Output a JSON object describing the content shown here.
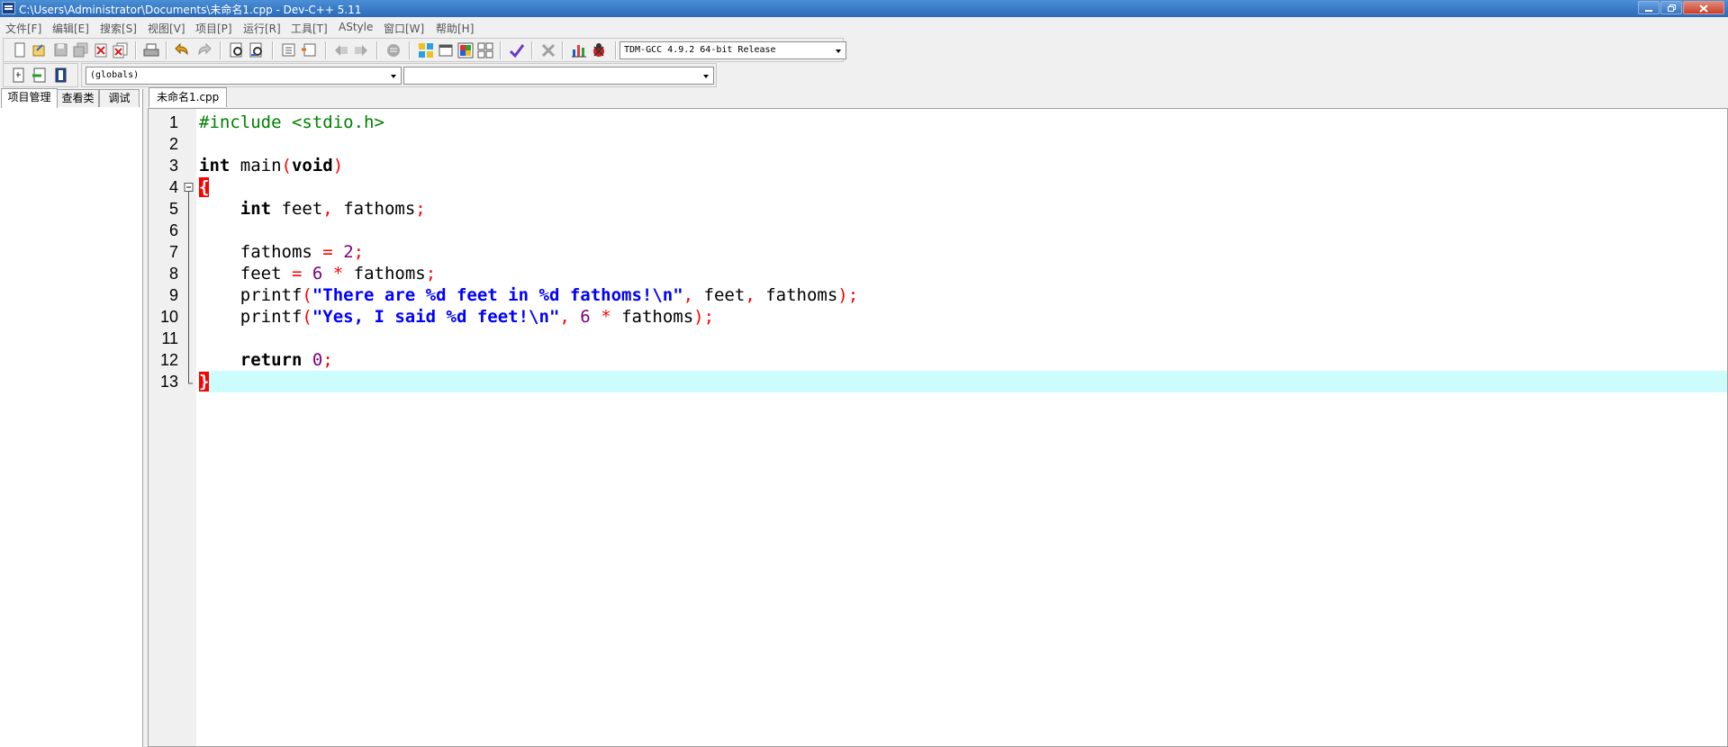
{
  "window": {
    "title": "C:\\Users\\Administrator\\Documents\\未命名1.cpp - Dev-C++ 5.11",
    "controls": [
      "minimize",
      "restore",
      "close"
    ]
  },
  "menu": {
    "items": [
      "文件[F]",
      "编辑[E]",
      "搜索[S]",
      "视图[V]",
      "项目[P]",
      "运行[R]",
      "工具[T]",
      "AStyle",
      "窗口[W]",
      "帮助[H]"
    ]
  },
  "toolbar": {
    "compiler_select": "TDM-GCC 4.9.2 64-bit Release",
    "scope_select": "(globals)",
    "member_select": "",
    "icons": [
      "new-file-icon",
      "open-file-icon",
      "save-icon",
      "save-all-icon",
      "close-file-icon",
      "close-all-icon",
      "print-icon",
      "undo-icon",
      "redo-icon",
      "find-icon",
      "replace-icon",
      "indent-icon",
      "unindent-icon",
      "prev-bookmark-icon",
      "next-bookmark-icon",
      "toggle-comment-icon",
      "compile-icon",
      "run-icon",
      "compile-run-icon",
      "rebuild-icon",
      "syntax-check-icon",
      "stop-icon",
      "profile-icon",
      "debug-icon",
      "new-project-icon",
      "add-to-project-icon",
      "project-options-icon"
    ]
  },
  "left_panel": {
    "tabs": [
      "项目管理",
      "查看类",
      "调试"
    ],
    "active_tab": "项目管理"
  },
  "editor": {
    "tabs": [
      "未命名1.cpp"
    ],
    "active_tab": "未命名1.cpp",
    "current_line": 13,
    "lines": [
      {
        "n": "1",
        "tokens": [
          [
            "pre",
            "#include <stdio.h>"
          ]
        ]
      },
      {
        "n": "2",
        "tokens": []
      },
      {
        "n": "3",
        "tokens": [
          [
            "kw",
            "int"
          ],
          [
            "id",
            " main"
          ],
          [
            "sym",
            "("
          ],
          [
            "kw",
            "void"
          ],
          [
            "sym",
            ")"
          ]
        ]
      },
      {
        "n": "4",
        "fold": "open",
        "tokens": [
          [
            "brace",
            "{"
          ]
        ]
      },
      {
        "n": "5",
        "tokens": [
          [
            "id",
            "    "
          ],
          [
            "kw",
            "int"
          ],
          [
            "id",
            " feet"
          ],
          [
            "sym",
            ","
          ],
          [
            "id",
            " fathoms"
          ],
          [
            "sym",
            ";"
          ]
        ]
      },
      {
        "n": "6",
        "tokens": []
      },
      {
        "n": "7",
        "tokens": [
          [
            "id",
            "    fathoms "
          ],
          [
            "sym",
            "="
          ],
          [
            "id",
            " "
          ],
          [
            "num",
            "2"
          ],
          [
            "sym",
            ";"
          ]
        ]
      },
      {
        "n": "8",
        "tokens": [
          [
            "id",
            "    feet "
          ],
          [
            "sym",
            "="
          ],
          [
            "id",
            " "
          ],
          [
            "num",
            "6"
          ],
          [
            "id",
            " "
          ],
          [
            "sym",
            "*"
          ],
          [
            "id",
            " fathoms"
          ],
          [
            "sym",
            ";"
          ]
        ]
      },
      {
        "n": "9",
        "tokens": [
          [
            "id",
            "    printf"
          ],
          [
            "sym",
            "("
          ],
          [
            "str",
            "\"There are %d feet in %d fathoms!\\n\""
          ],
          [
            "sym",
            ","
          ],
          [
            "id",
            " feet"
          ],
          [
            "sym",
            ","
          ],
          [
            "id",
            " fathoms"
          ],
          [
            "sym",
            ");"
          ]
        ]
      },
      {
        "n": "10",
        "tokens": [
          [
            "id",
            "    printf"
          ],
          [
            "sym",
            "("
          ],
          [
            "str",
            "\"Yes, I said %d feet!\\n\""
          ],
          [
            "sym",
            ","
          ],
          [
            "id",
            " "
          ],
          [
            "num",
            "6"
          ],
          [
            "id",
            " "
          ],
          [
            "sym",
            "*"
          ],
          [
            "id",
            " fathoms"
          ],
          [
            "sym",
            ");"
          ]
        ]
      },
      {
        "n": "11",
        "tokens": []
      },
      {
        "n": "12",
        "tokens": [
          [
            "id",
            "    "
          ],
          [
            "kw",
            "return"
          ],
          [
            "id",
            " "
          ],
          [
            "num",
            "0"
          ],
          [
            "sym",
            ";"
          ]
        ]
      },
      {
        "n": "13",
        "fold": "end",
        "tokens": [
          [
            "brace",
            "}"
          ]
        ]
      }
    ]
  },
  "colors": {
    "preprocessor": "#008000",
    "keyword": "#000000",
    "symbol": "#ff0000",
    "number": "#800080",
    "string": "#0000ff",
    "current_line_bg": "#ccfcfc",
    "brace_match_bg": "#ff0000"
  }
}
